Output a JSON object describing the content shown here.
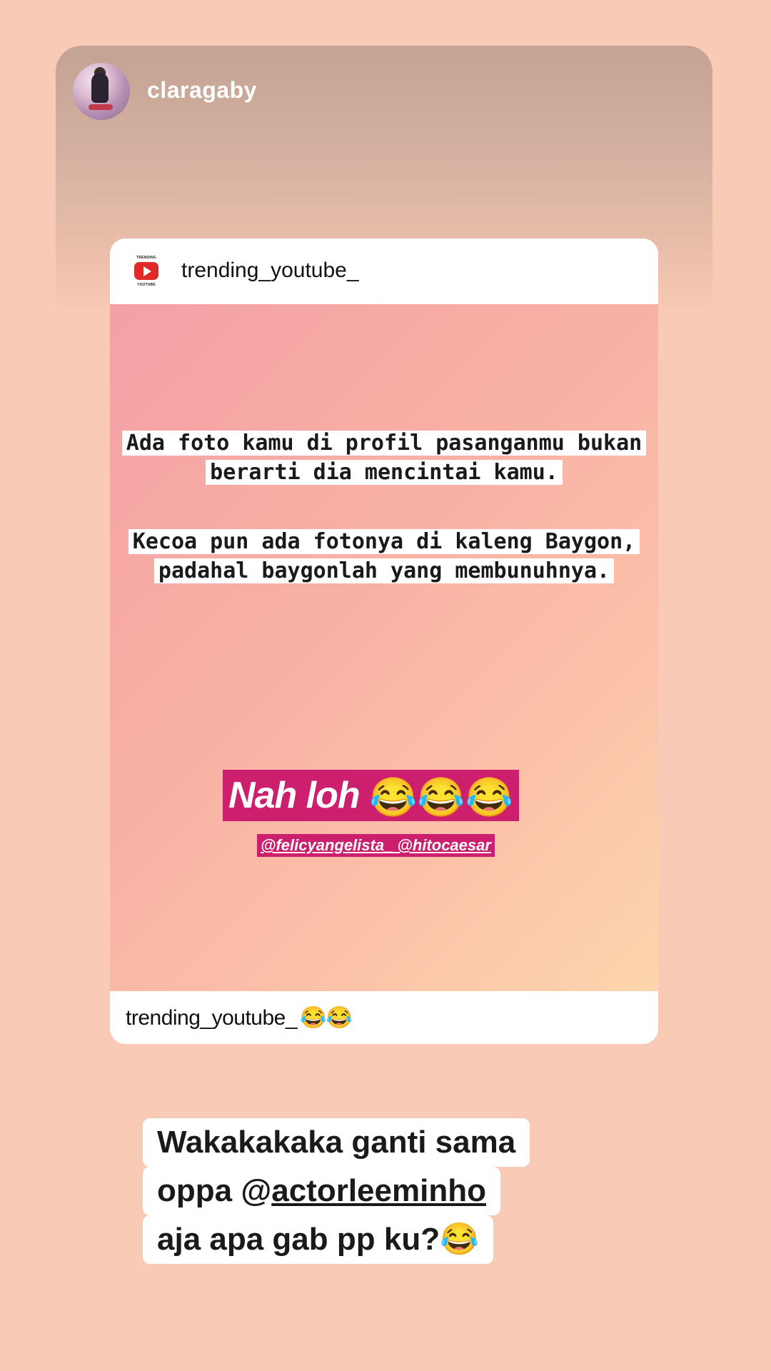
{
  "story": {
    "username": "claragaby",
    "avatar_icon": "profile-avatar"
  },
  "post": {
    "username": "trending_youtube_",
    "logo_icon": "youtube-play-icon",
    "logo_text_top": "TRENDING",
    "logo_text_bottom": "YOUTUBE",
    "quote_paragraph_1": "Ada foto kamu di profil pasanganmu bukan berarti dia mencintai kamu.",
    "quote_paragraph_2": "Kecoa pun ada fotonya di kaleng Baygon, padahal baygonlah yang membunuhnya.",
    "highlight_text": "Nah loh",
    "highlight_emojis": "😂😂😂",
    "tags_text": "@felicyangelista_ @hitocaesar",
    "caption_username": "trending_youtube_",
    "caption_emojis": "😂😂"
  },
  "reply": {
    "line1": "Wakakakaka ganti sama",
    "line2_prefix": "oppa @",
    "line2_mention": "actorleeminho",
    "line3": "aja apa gab pp ku?",
    "line3_emoji": "😂"
  },
  "colors": {
    "background": "#f9cbb6",
    "highlight": "#cc1f6e"
  }
}
